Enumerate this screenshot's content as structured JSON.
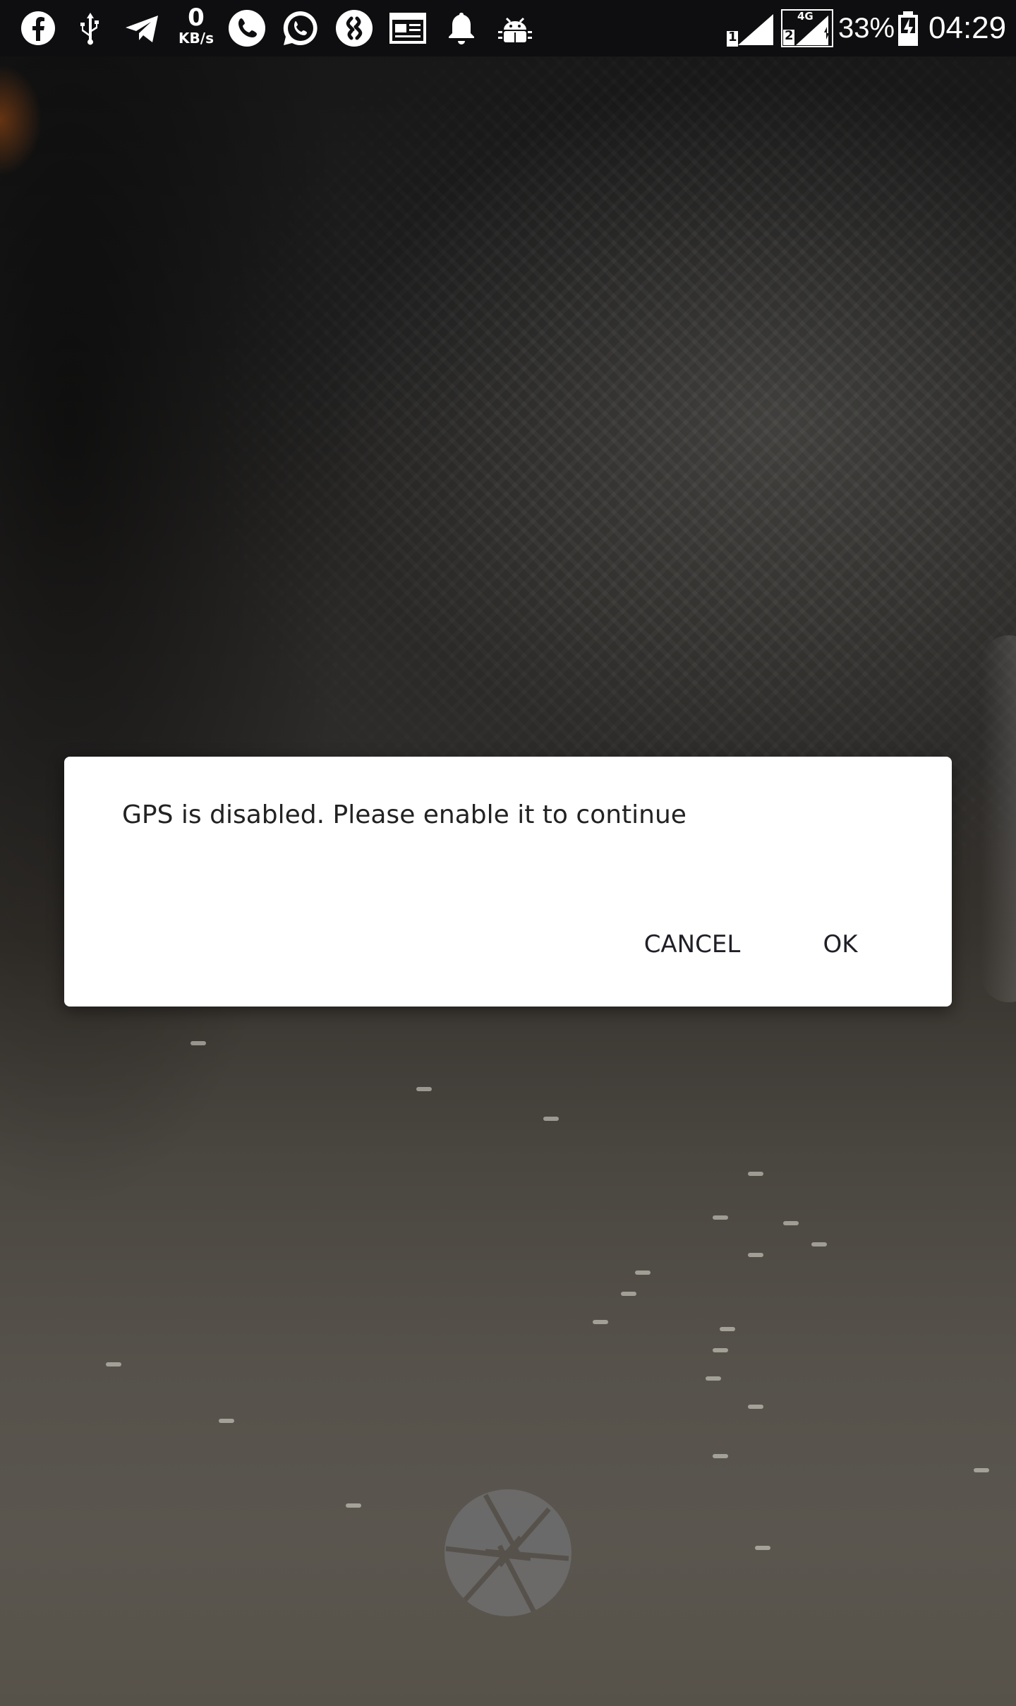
{
  "status_bar": {
    "icons": [
      "facebook-icon",
      "usb-icon",
      "telegram-icon",
      "phone-call-icon",
      "whatsapp-icon",
      "shazam-icon",
      "news-icon",
      "notification-bell-icon",
      "android-debug-icon",
      "sim1-signal-icon",
      "sim2-4g-signal-icon",
      "battery-charging-icon"
    ],
    "network_speed_value": "0",
    "network_speed_unit": "KB/s",
    "sim1_label": "1",
    "sim2_label": "2",
    "sim2_network": "4G",
    "battery_percent": "33%",
    "time": "04:29"
  },
  "dialog": {
    "message": "GPS is disabled. Please enable it to continue",
    "cancel_label": "CANCEL",
    "ok_label": "OK"
  },
  "camera": {
    "shutter_icon": "camera-shutter-icon"
  },
  "colors": {
    "status_bar_bg": "#0e0e10",
    "dialog_bg": "#ffffff",
    "dialog_text": "#222222",
    "button_text": "#1f1f28"
  }
}
